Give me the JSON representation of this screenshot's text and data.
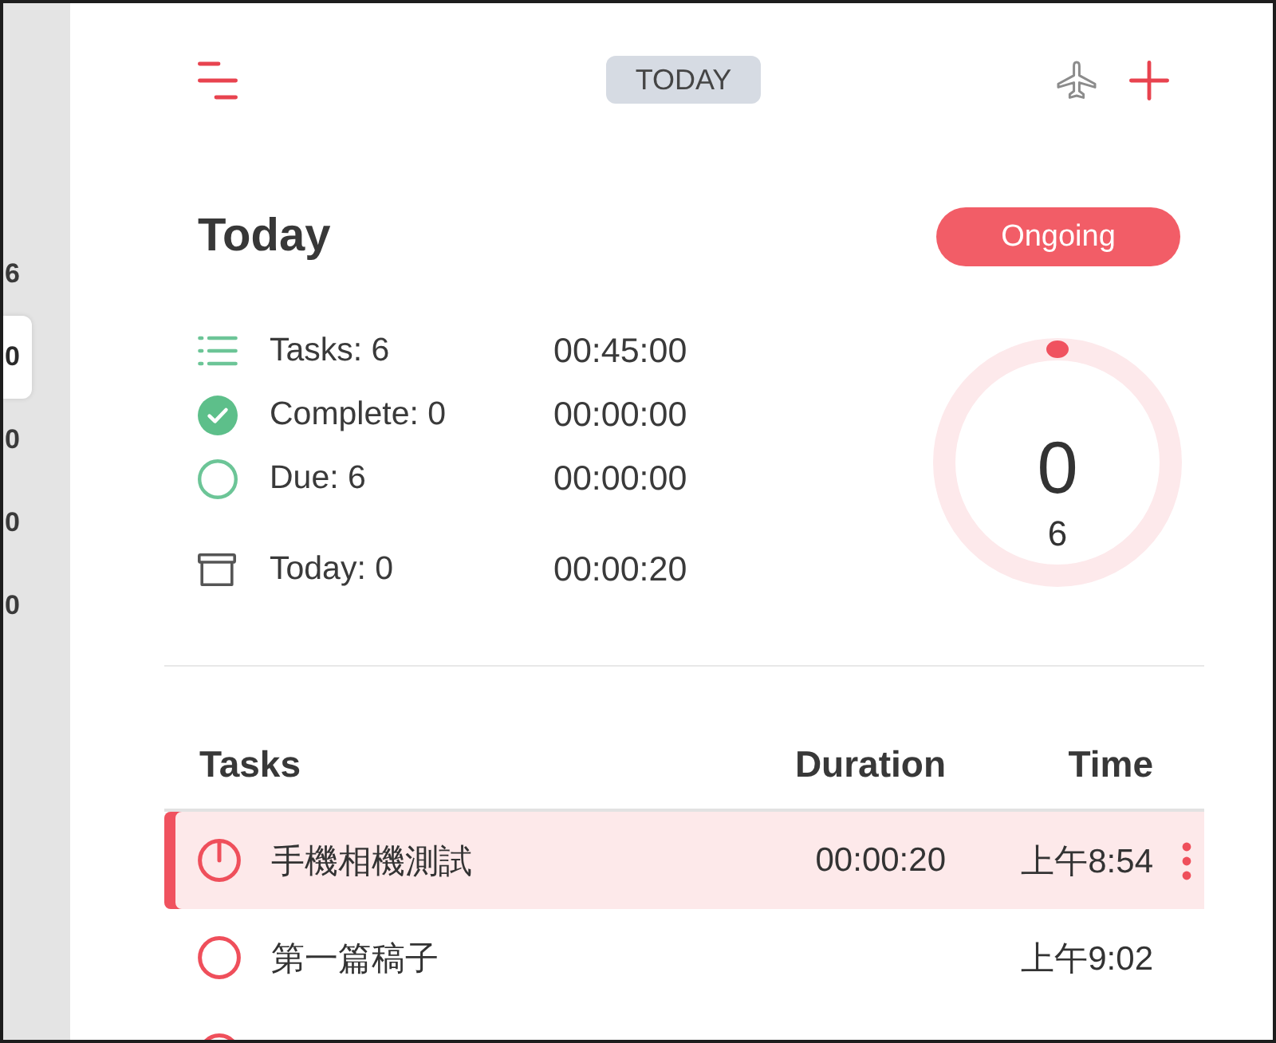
{
  "sidebar": {
    "items": [
      {
        "label": "6",
        "selected": false
      },
      {
        "label": "0",
        "selected": true
      },
      {
        "label": "0",
        "selected": false
      },
      {
        "label": "0",
        "selected": false
      },
      {
        "label": "0",
        "selected": false
      }
    ]
  },
  "toolbar": {
    "date_button": "TODAY"
  },
  "summary": {
    "title": "Today",
    "status": "Ongoing",
    "stats": [
      {
        "kind": "tasks",
        "label": "Tasks: 6",
        "time": "00:45:00"
      },
      {
        "kind": "complete",
        "label": "Complete: 0",
        "time": "00:00:00"
      },
      {
        "kind": "due",
        "label": "Due: 6",
        "time": "00:00:00"
      },
      {
        "kind": "today",
        "label": "Today: 0",
        "time": "00:00:20"
      }
    ],
    "ring": {
      "count": "0",
      "total": "6"
    }
  },
  "table": {
    "columns": [
      "Tasks",
      "Duration",
      "Time"
    ],
    "rows": [
      {
        "title": "手機相機測試",
        "duration": "00:00:20",
        "time": "上午8:54",
        "selected": true,
        "running": true
      },
      {
        "title": "第一篇稿子",
        "time": "上午9:02",
        "selected": false,
        "running": false
      },
      {
        "selected": false,
        "running": false
      }
    ]
  }
}
